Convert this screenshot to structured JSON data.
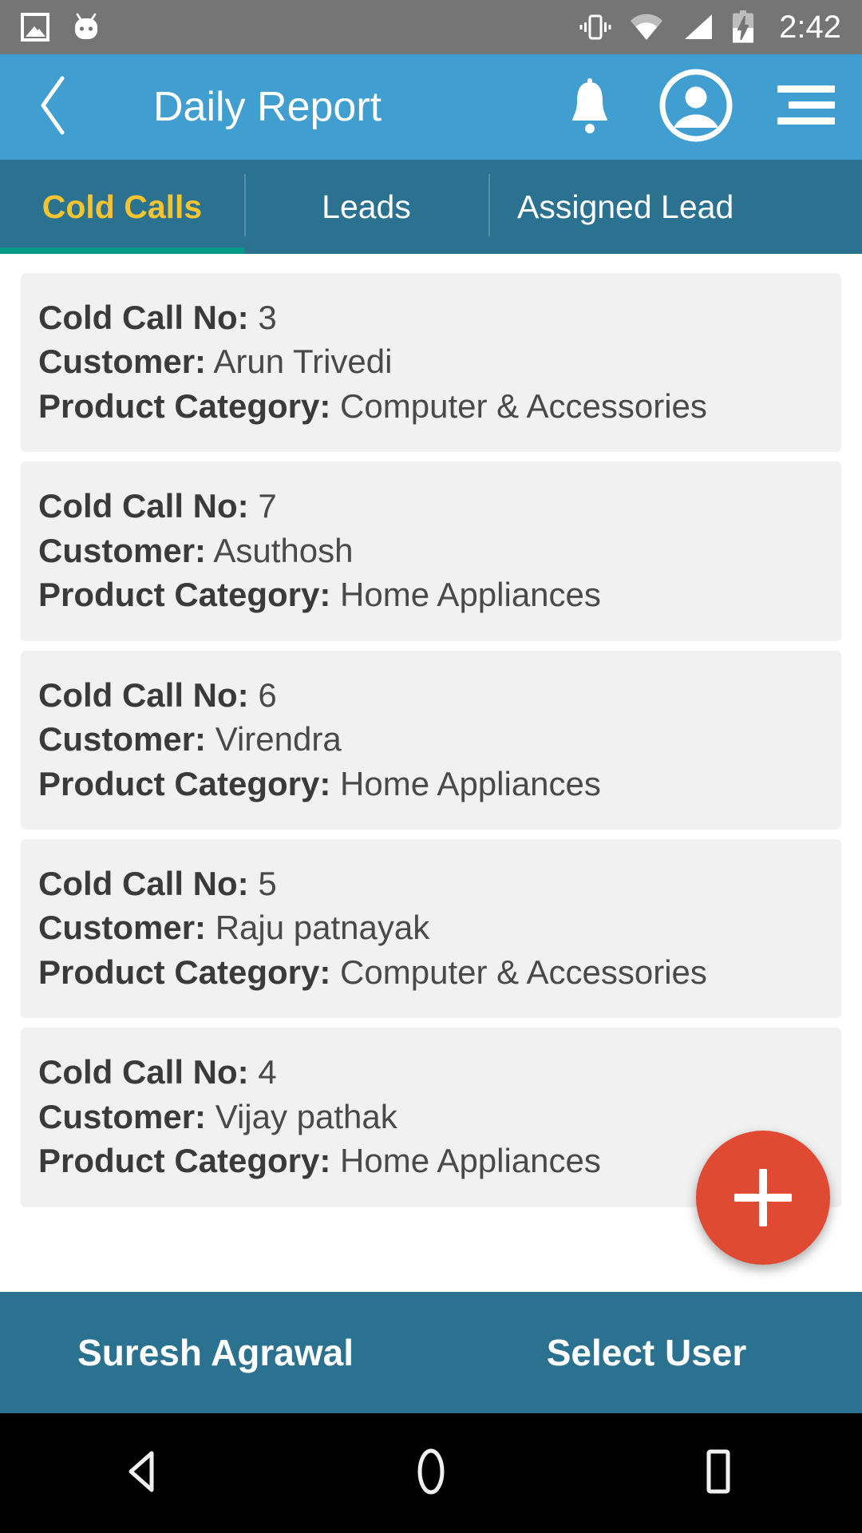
{
  "status_bar": {
    "time": "2:42",
    "icons": [
      "photo-icon",
      "android-mascot-icon",
      "vibrate-icon",
      "wifi-icon",
      "signal-icon",
      "battery-charging-icon"
    ],
    "background": "#757575"
  },
  "app_bar": {
    "title": "Daily Report",
    "back_icon": "chevron-left-icon",
    "notification_icon": "bell-icon",
    "profile_icon": "account-circle-icon",
    "menu_icon": "hamburger-menu-icon",
    "background": "#419ed0"
  },
  "tabs": {
    "background": "#2b7190",
    "active_color": "#f5c431",
    "indicator_color": "#049a85",
    "active_index": 0,
    "items": [
      {
        "label": "Cold Calls"
      },
      {
        "label": "Leads"
      },
      {
        "label": "Assigned Lead"
      }
    ]
  },
  "list": {
    "labels": {
      "cold_call_no": "Cold Call No:",
      "customer": "Customer:",
      "product_category": "Product Category:"
    },
    "cards": [
      {
        "cold_call_no": "3",
        "customer": "Arun Trivedi",
        "product_category": "Computer & Accessories"
      },
      {
        "cold_call_no": "7",
        "customer": "Asuthosh",
        "product_category": "Home Appliances"
      },
      {
        "cold_call_no": "6",
        "customer": "Virendra",
        "product_category": "Home Appliances"
      },
      {
        "cold_call_no": "5",
        "customer": "Raju patnayak",
        "product_category": "Computer & Accessories"
      },
      {
        "cold_call_no": "4",
        "customer": "Vijay pathak",
        "product_category": "Home Appliances"
      }
    ]
  },
  "fab": {
    "icon": "plus-icon",
    "color": "#e04a32"
  },
  "bottom_bar": {
    "background": "#2b7190",
    "user_name": "Suresh Agrawal",
    "select_user_label": "Select User"
  },
  "nav_bar": {
    "background": "#000000",
    "back_icon": "triangle-back-icon",
    "home_icon": "circle-home-icon",
    "recents_icon": "square-recents-icon"
  }
}
